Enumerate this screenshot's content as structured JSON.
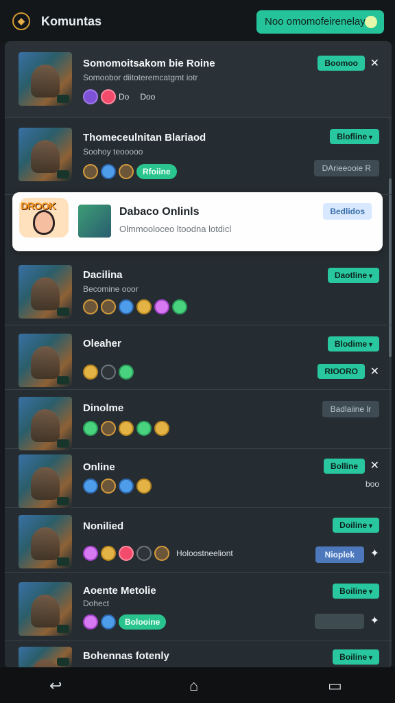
{
  "header": {
    "logo_icon": "game-icon",
    "title": "Komuntas",
    "action": "Noo omomofeirenelay"
  },
  "items": [
    {
      "title": "Somomoitsakom bie Roine",
      "subtitle": "Somoobor diitoteremcatgmt iotr",
      "button": "Boomoo",
      "stats": "Do",
      "badge": "Doo"
    },
    {
      "title": "Thomeceulnitan Blariaod",
      "subtitle": "Soohoy teooooo",
      "button": "Blofline",
      "status": "Rfoiine",
      "side": "DArieeooie R"
    },
    {
      "title": "Dacilina",
      "subtitle": "Becomine ooor",
      "button": "Daotline"
    },
    {
      "title": "Oleaher",
      "button": "Blodime",
      "side": "RIOORO"
    },
    {
      "title": "Dinolme",
      "side": "Badlaiine lr"
    },
    {
      "title": "Online",
      "button": "Bolline",
      "side": "boo"
    },
    {
      "title": "Nonilied",
      "button": "Doiline",
      "side": "Nioplek",
      "text": "Holoostneeliont"
    },
    {
      "title": "Aoente Metolie",
      "subtitle": "Dohect",
      "button": "Boiline",
      "status": "Bolooine"
    },
    {
      "title": "Bohennas fotenly",
      "button": "Boiline"
    }
  ],
  "featured": {
    "title": "Dabaco Onlinls",
    "subtitle": "Olmmooloceo ltoodna lotdicl",
    "button": "Bedlidos"
  }
}
